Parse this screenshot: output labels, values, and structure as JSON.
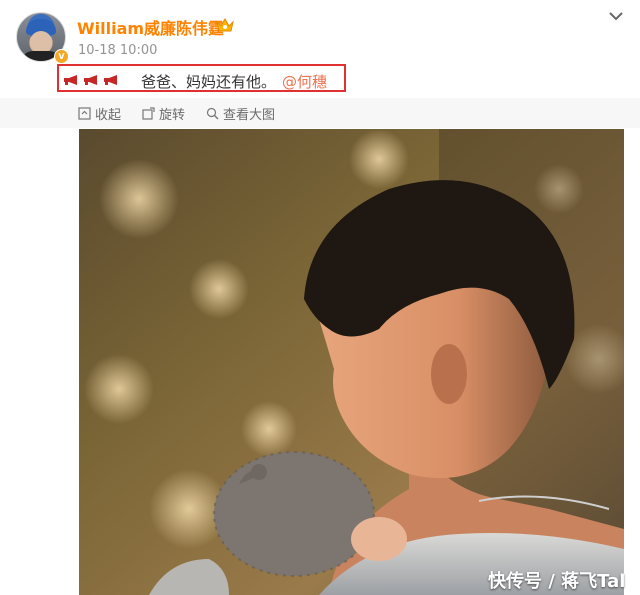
{
  "post": {
    "username": "William威廉陈伟霆",
    "timestamp": "10-18 10:00",
    "text": "爸爸、妈妈还有他。",
    "mention": "@何穗",
    "vip_icon": "crown-vip-icon",
    "verified_icon": "verified-v-icon"
  },
  "actions": {
    "collapse": "收起",
    "rotate": "旋转",
    "view_large": "查看大图"
  },
  "watermark": "快传号 / 蒋飞Tal",
  "colors": {
    "username": "#ff8200",
    "mention": "#eb7350",
    "highlight_box": "#e03030"
  }
}
